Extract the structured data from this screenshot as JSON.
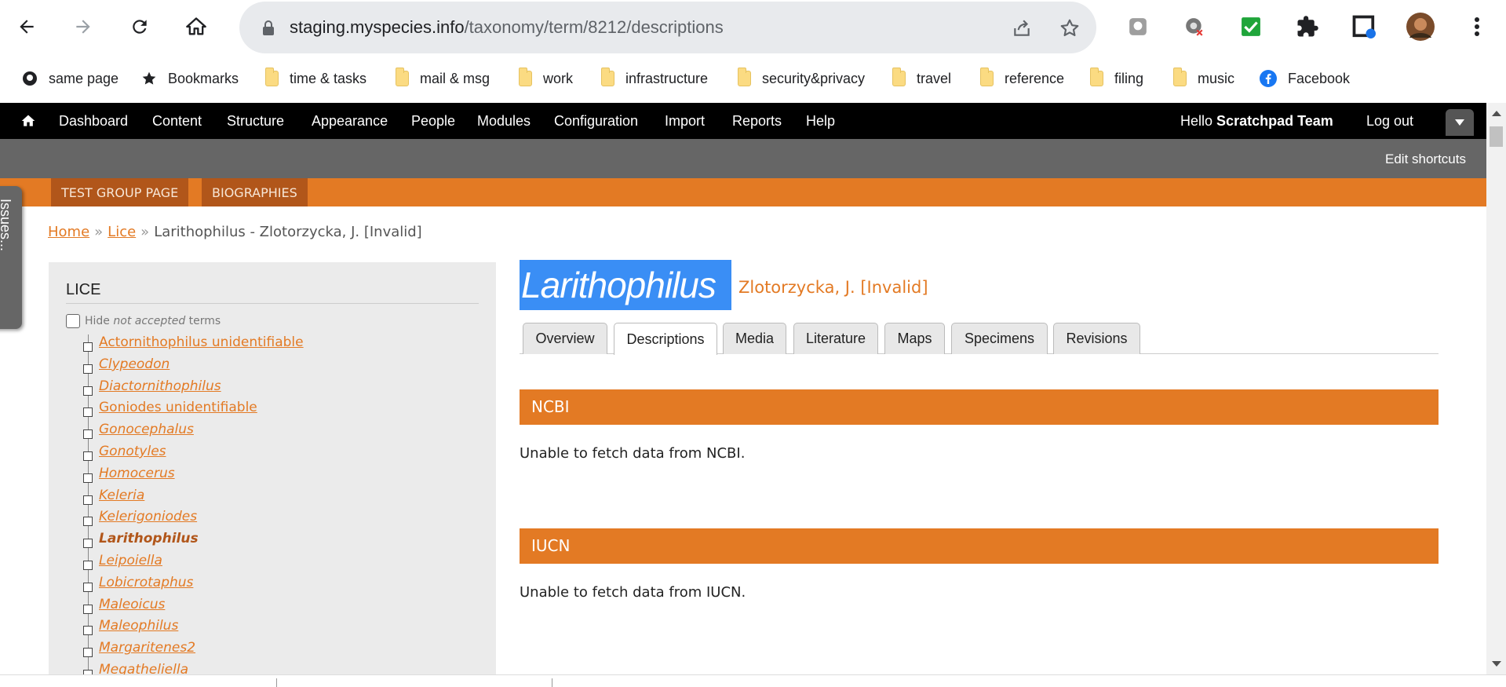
{
  "browser": {
    "url_host": "staging.myspecies.info",
    "url_path": "/taxonomy/term/8212/descriptions"
  },
  "bookmarks": [
    {
      "label": "same page",
      "icon": "github-icon"
    },
    {
      "label": "Bookmarks",
      "icon": "star-icon"
    },
    {
      "label": "time & tasks",
      "icon": "folder-icon"
    },
    {
      "label": "mail & msg",
      "icon": "folder-icon"
    },
    {
      "label": "work",
      "icon": "folder-icon"
    },
    {
      "label": "infrastructure",
      "icon": "folder-icon"
    },
    {
      "label": "security&privacy",
      "icon": "folder-icon"
    },
    {
      "label": "travel",
      "icon": "folder-icon"
    },
    {
      "label": "reference",
      "icon": "folder-icon"
    },
    {
      "label": "filing",
      "icon": "folder-icon"
    },
    {
      "label": "music",
      "icon": "folder-icon"
    },
    {
      "label": "Facebook",
      "icon": "facebook-icon"
    }
  ],
  "admin_menu": {
    "items": [
      "Dashboard",
      "Content",
      "Structure",
      "Appearance",
      "People",
      "Modules",
      "Configuration",
      "Import",
      "Reports",
      "Help"
    ],
    "hello": "Hello",
    "user": "Scratchpad Team",
    "logout": "Log out",
    "edit_shortcuts": "Edit shortcuts"
  },
  "site_tabs": [
    "TEST GROUP PAGE",
    "BIOGRAPHIES"
  ],
  "issues_tab": "Issues...",
  "breadcrumb": {
    "home": "Home",
    "sep": "»",
    "parent": "Lice",
    "current": "Larithophilus - Zlotorzycka, J. [Invalid]"
  },
  "sidebar": {
    "title": "LICE",
    "hide_label": "Hide",
    "hide_emphasis": "not accepted",
    "hide_suffix": "terms",
    "items": [
      "Actornithophilus unidentifiable",
      "Clypeodon",
      "Diactornithophilus",
      "Goniodes unidentifiable",
      "Gonocephalus",
      "Gonotyles",
      "Homocerus",
      "Keleria",
      "Kelerigoniodes",
      "Larithophilus",
      "Leipoiella",
      "Lobicrotaphus",
      "Maleoicus",
      "Maleophilus",
      "Margaritenes2",
      "Megatheliella"
    ]
  },
  "taxon": {
    "name": "Larithophilus",
    "author": "Zlotorzycka, J. [Invalid]"
  },
  "tabs": [
    "Overview",
    "Descriptions",
    "Media",
    "Literature",
    "Maps",
    "Specimens",
    "Revisions"
  ],
  "active_tab": "Descriptions",
  "sections": [
    {
      "title": "NCBI",
      "text": "Unable to fetch data from NCBI."
    },
    {
      "title": "IUCN",
      "text": "Unable to fetch data from IUCN."
    }
  ],
  "colors": {
    "accent": "#e37a24",
    "accent_dark": "#b1561a",
    "selection": "#3a8ef5"
  }
}
